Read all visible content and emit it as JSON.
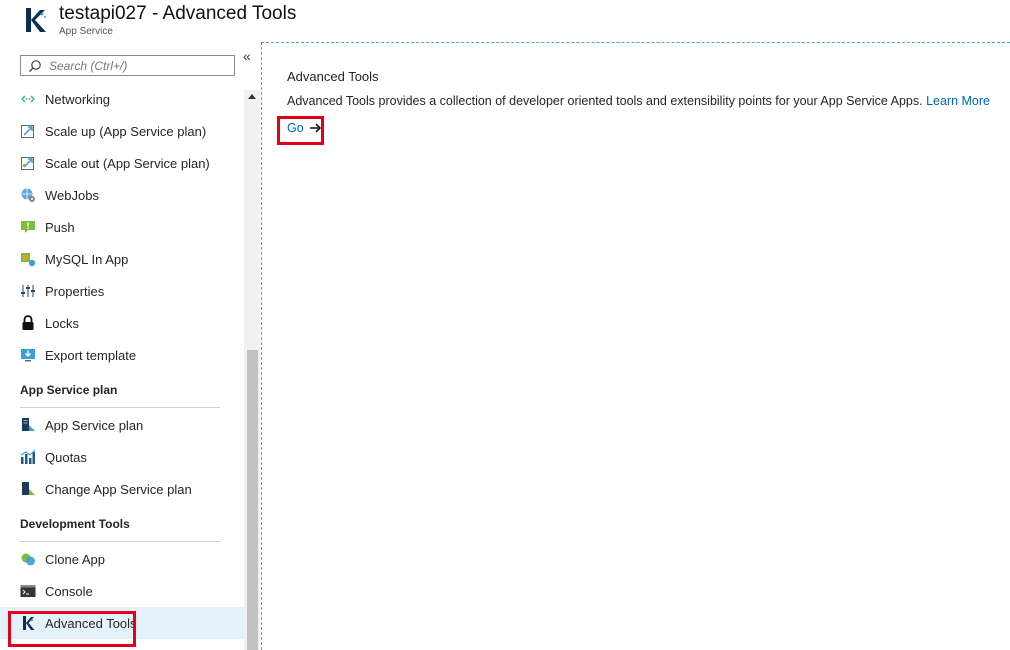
{
  "header": {
    "title": "testapi027 - Advanced Tools",
    "subtitle": "App Service"
  },
  "sidebar": {
    "collapse_label": "«",
    "search_placeholder": "Search (Ctrl+/)",
    "items_top": [
      {
        "label": "Networking",
        "icon": "networking-icon"
      },
      {
        "label": "Scale up (App Service plan)",
        "icon": "scale-up-icon"
      },
      {
        "label": "Scale out (App Service plan)",
        "icon": "scale-out-icon"
      },
      {
        "label": "WebJobs",
        "icon": "webjobs-icon"
      },
      {
        "label": "Push",
        "icon": "push-icon"
      },
      {
        "label": "MySQL In App",
        "icon": "mysql-icon"
      },
      {
        "label": "Properties",
        "icon": "properties-icon"
      },
      {
        "label": "Locks",
        "icon": "lock-icon"
      },
      {
        "label": "Export template",
        "icon": "export-template-icon"
      }
    ],
    "section_plan": {
      "header": "App Service plan",
      "items": [
        {
          "label": "App Service plan",
          "icon": "app-service-plan-icon"
        },
        {
          "label": "Quotas",
          "icon": "quotas-icon"
        },
        {
          "label": "Change App Service plan",
          "icon": "change-plan-icon"
        }
      ]
    },
    "section_dev": {
      "header": "Development Tools",
      "items": [
        {
          "label": "Clone App",
          "icon": "clone-app-icon"
        },
        {
          "label": "Console",
          "icon": "console-icon"
        },
        {
          "label": "Advanced Tools",
          "icon": "advanced-tools-icon",
          "active": true
        }
      ]
    }
  },
  "main": {
    "title": "Advanced Tools",
    "description": "Advanced Tools provides a collection of developer oriented tools and extensibility points for your App Service Apps.",
    "learn_more": "Learn More",
    "go_label": "Go"
  },
  "colors": {
    "accent_link": "#0065b3",
    "highlight_box": "#e3001b",
    "active_bg": "#e6f2fb"
  }
}
